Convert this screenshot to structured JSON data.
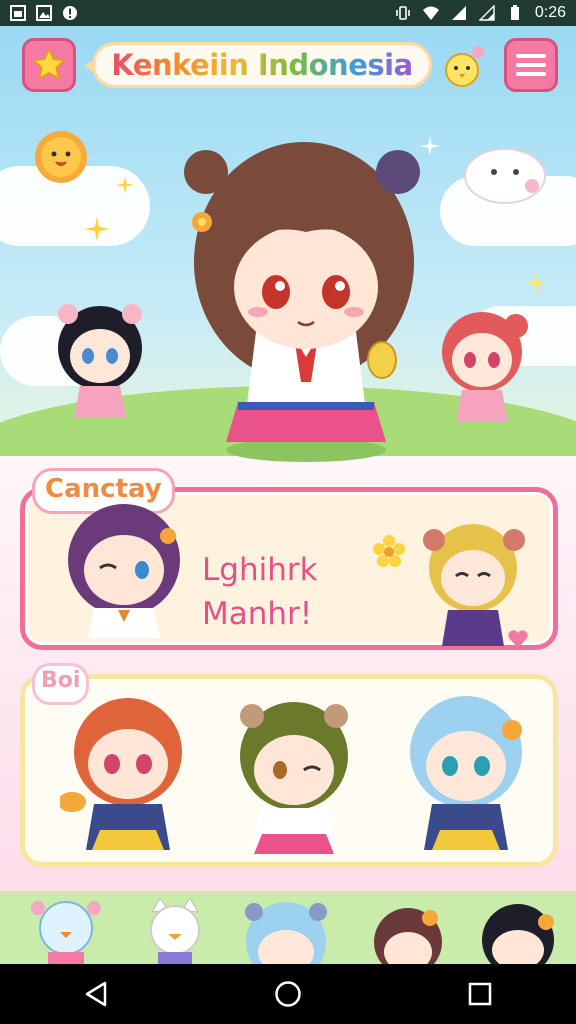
{
  "status_bar": {
    "time": "0:26",
    "icons": [
      "gallery-icon",
      "image-icon",
      "alert-icon",
      "vibrate-icon",
      "wifi-icon",
      "signal-icon",
      "signal-low-icon",
      "battery-icon"
    ]
  },
  "header": {
    "title": "Kenkeiin Indonesia",
    "left_button_icon": "star-icon",
    "right_button_icon": "menu-icon"
  },
  "cards": [
    {
      "tag": "Canctay",
      "message_line_1": "Lghihrk",
      "message_line_2": "Manhr!"
    },
    {
      "tag": "Boi"
    }
  ],
  "nav": {
    "back_icon": "back-triangle-icon",
    "home_icon": "home-circle-icon",
    "recents_icon": "recents-square-icon"
  },
  "colors": {
    "status_bar": "#1f3b33",
    "accent_pink": "#f47aa3",
    "card1_border": "#ef6f97",
    "card2_border": "#f6e6a0",
    "message_text": "#e2528a",
    "tag_text": "#f18b3f"
  }
}
